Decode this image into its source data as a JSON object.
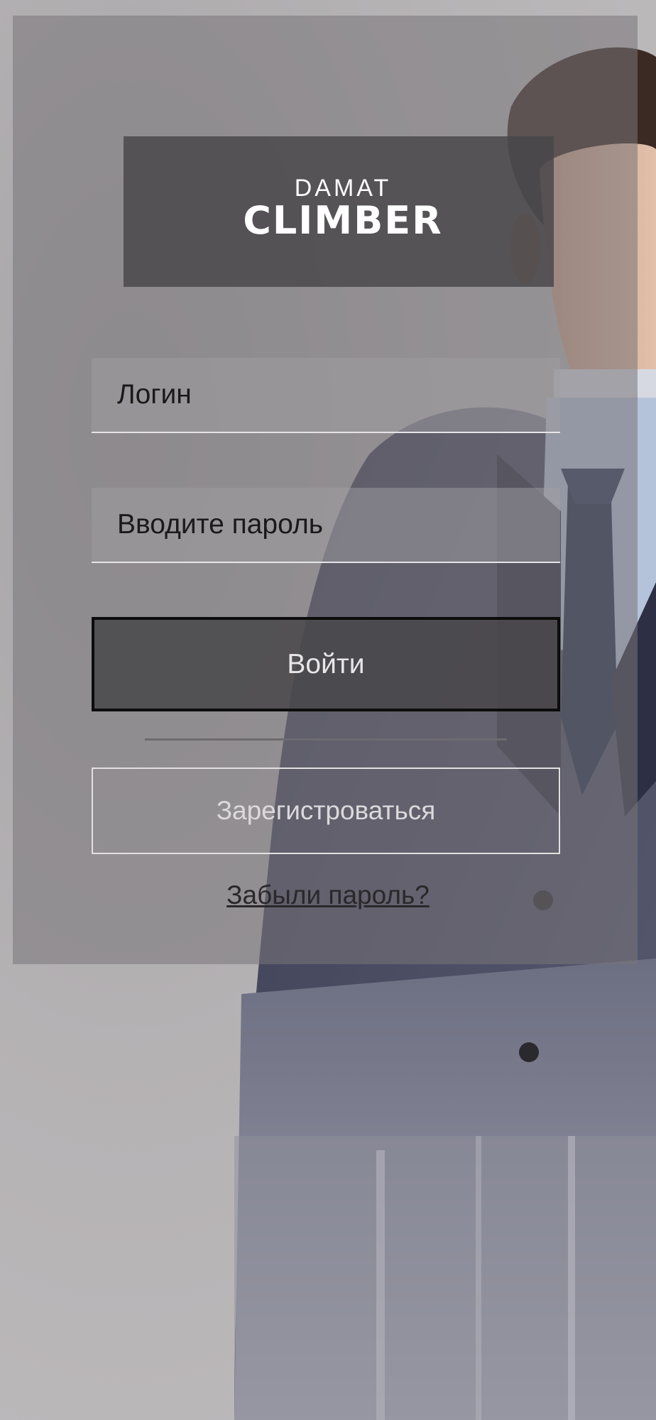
{
  "brand": {
    "line1": "DAMAT",
    "line2": "CLIMBER"
  },
  "form": {
    "login_placeholder": "Логин",
    "password_placeholder": "Вводите пароль",
    "submit_label": "Войти",
    "register_label": "Зарегистроваться",
    "forgot_label": "Забыли пароль?"
  },
  "icons": {
    "background": "man-in-suit-photo"
  }
}
